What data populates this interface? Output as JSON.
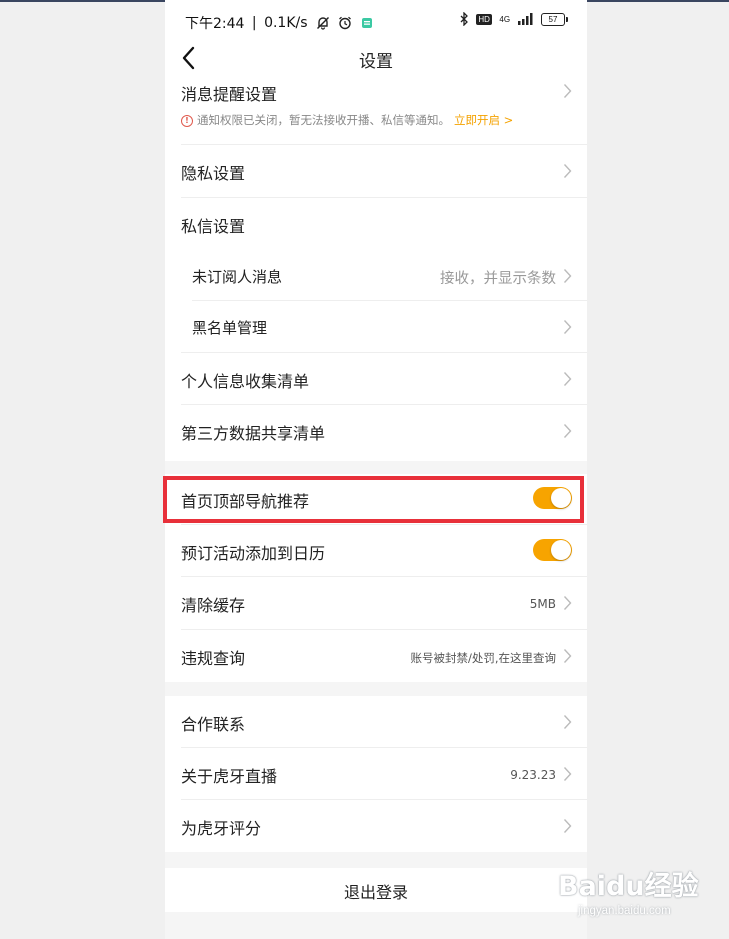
{
  "status_bar": {
    "time": "下午2:44",
    "separator": "|",
    "speed": "0.1K/s",
    "network": "4G",
    "hd_badge": "HD",
    "battery": "57"
  },
  "nav": {
    "title": "设置"
  },
  "notification": {
    "label": "消息提醒设置",
    "notice": "通知权限已关闭，暂无法接收开播、私信等通知。",
    "action": "立即开启 >"
  },
  "privacy": {
    "label": "隐私设置"
  },
  "dm": {
    "label": "私信设置",
    "unsubscribed": {
      "label": "未订阅人消息",
      "value": "接收，并显示条数"
    },
    "blacklist": {
      "label": "黑名单管理"
    }
  },
  "info_list": {
    "label": "个人信息收集清单"
  },
  "third_party": {
    "label": "第三方数据共享清单"
  },
  "nav_recommend": {
    "label": "首页顶部导航推荐",
    "enabled": true
  },
  "calendar": {
    "label": "预订活动添加到日历",
    "enabled": true
  },
  "cache": {
    "label": "清除缓存",
    "value": "5MB"
  },
  "violation": {
    "label": "违规查询",
    "value": "账号被封禁/处罚,在这里查询"
  },
  "cooperation": {
    "label": "合作联系"
  },
  "about": {
    "label": "关于虎牙直播",
    "value": "9.23.23"
  },
  "rate": {
    "label": "为虎牙评分"
  },
  "logout": {
    "label": "退出登录"
  },
  "watermark": {
    "main": "Baidu经验",
    "sub": "jingyan.baidu.com"
  },
  "colors": {
    "accent": "#f7a400",
    "highlight": "#e8303a",
    "warning": "#e05a4e"
  }
}
